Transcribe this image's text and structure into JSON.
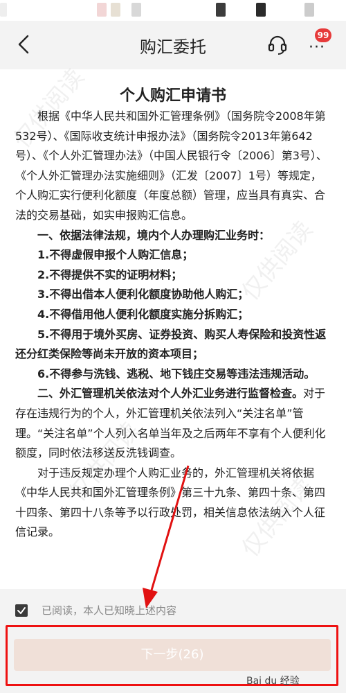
{
  "header": {
    "title": "购汇委托",
    "badge_count": "99"
  },
  "document": {
    "title": "个人购汇申请书",
    "intro": "根据《中华人民共和国外汇管理条例》（国务院令2008年第532号）、《国际收支统计申报办法》（国务院令2013年第642号）、《个人外汇管理办法》（中国人民银行令〔2006〕第3号）、《个人外汇管理办法实施细则》（汇发〔2007〕1号）等规定，个人购汇实行便利化额度（年度总额）管理，应当具有真实、合法的交易基础，如实申报购汇信息。",
    "section1_heading": "一、依据法律法规，境内个人办理购汇业务时：",
    "section1_items": [
      "1.不得虚假申报个人购汇信息；",
      "2.不得提供不实的证明材料；",
      "3.不得出借本人便利化额度协助他人购汇；",
      "4.不得借用他人便利化额度实施分拆购汇；",
      "5.不得用于境外买房、证券投资、购买人寿保险和投资性返还分红类保险等尚未开放的资本项目；",
      "6.不得参与洗钱、逃税、地下钱庄交易等违法违规活动。"
    ],
    "section2_heading": "二、外汇管理机关依法对个人外汇业务进行监督检查。",
    "section2_text": "对于存在违规行为的个人，外汇管理机关依法列入“关注名单”管理。“关注名单”个人列入名单当年及之后两年不享有个人便利化额度，同时依法移送反洗钱调查。",
    "section3_text": "对于违反规定办理个人购汇业务的，外汇管理机关将依据《中华人民共和国外汇管理条例》第三十九条、第四十条、第四十四条、第四十八条等予以行政处罚，相关信息依法纳入个人征信记录。",
    "watermark": "仅供阅读"
  },
  "agreement": {
    "checked": true,
    "label": "已阅读，本人已知晓上述内容"
  },
  "footer": {
    "next_label": "下一步(26)",
    "logo_text": "Bai du 经验"
  },
  "colors": {
    "highlight": "#e11111",
    "badge": "#e63a3a",
    "button_disabled": "#f0e0d8"
  }
}
